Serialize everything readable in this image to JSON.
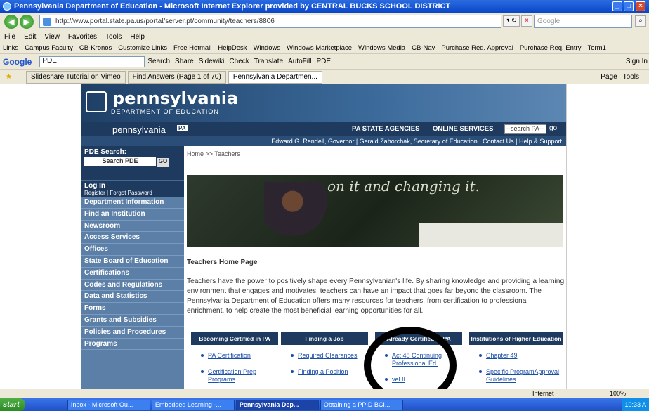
{
  "window": {
    "title": "Pennsylvania Department of Education - Microsoft Internet Explorer provided by CENTRAL BUCKS SCHOOL DISTRICT"
  },
  "nav": {
    "address": "http://www.portal.state.pa.us/portal/server.pt/community/teachers/8806",
    "search_placeholder": "Google"
  },
  "menu": [
    "File",
    "Edit",
    "View",
    "Favorites",
    "Tools",
    "Help"
  ],
  "links": [
    "Links",
    "Campus Faculty",
    "CB-Kronos",
    "Customize Links",
    "Free Hotmail",
    "HelpDesk",
    "Windows",
    "Windows Marketplace",
    "Windows Media",
    "CB-Nav",
    "Purchase Req. Approval",
    "Purchase Req. Entry",
    "Term1"
  ],
  "google": {
    "label": "Google",
    "value": "PDE",
    "items": [
      "Search",
      "Share",
      "Sidewiki",
      "Check",
      "Translate",
      "AutoFill",
      "PDE"
    ],
    "signin": "Sign In"
  },
  "tabs": [
    "Slideshare Tutorial on Vimeo",
    "Find Answers (Page 1 of 70)",
    "Pennsylvania Departmen..."
  ],
  "tools": [
    "Page",
    "Tools"
  ],
  "site": {
    "logo": "pennsylvania",
    "logo_sub": "DEPARTMENT OF EDUCATION",
    "pa_word": "pennsylvania",
    "pa_badge": "PA",
    "agencies": "PA STATE AGENCIES",
    "online": "ONLINE SERVICES",
    "site_search": "--search PA--",
    "go": "go",
    "govline": "Edward G. Rendell, Governor | Gerald Zahorchak, Secretary of Education | Contact Us | Help & Support"
  },
  "sidebar": {
    "search_label": "PDE Search:",
    "search_value": "Search PDE",
    "go": "GO",
    "login": "Log In",
    "login_sub": "Register | Forgot Password",
    "items": [
      "Department Information",
      "Find an Institution",
      "Newsroom",
      "Access Services",
      "Offices",
      "State Board of Education",
      "Certifications",
      "Codes and Regulations",
      "Data and Statistics",
      "Forms",
      "Grants and Subsidies",
      "Policies and Procedures",
      "Programs"
    ]
  },
  "main": {
    "crumb": "Home >> Teachers",
    "chalk": "on it and changing it.",
    "heading": "Teachers Home Page",
    "intro": "Teachers have the power to positively shape every Pennsylvanian's life. By sharing knowledge and providing a learning environment that engages and motivates, teachers can have an impact that goes far beyond the classroom. The Pennsylvania Department of Education offers many resources for teachers, from certification to professional enrichment, to help create the most beneficial learning opportunities for all.",
    "columns": [
      {
        "title": "Becoming Certified in PA",
        "links": [
          "PA Certification",
          "Certification Prep Programs"
        ]
      },
      {
        "title": "Finding a Job",
        "links": [
          "Required Clearances",
          "Finding a Position"
        ]
      },
      {
        "title": "Already Certified in PA",
        "links": [
          "Act 48 Continuing Professional Ed.",
          "vel II"
        ]
      },
      {
        "title": "Institutions of Higher Education",
        "links": [
          "Chapter 49",
          "Specific ProgramApproval Guidelines"
        ]
      }
    ]
  },
  "status": {
    "zone": "Internet",
    "zoom": "100%"
  },
  "taskbar": {
    "start": "start",
    "tasks": [
      "Inbox - Microsoft Ou...",
      "Embedded Learning -...",
      "Pennsylvania Dep...",
      "Obtaining a PPID BCI..."
    ],
    "time": "10:33 A"
  }
}
